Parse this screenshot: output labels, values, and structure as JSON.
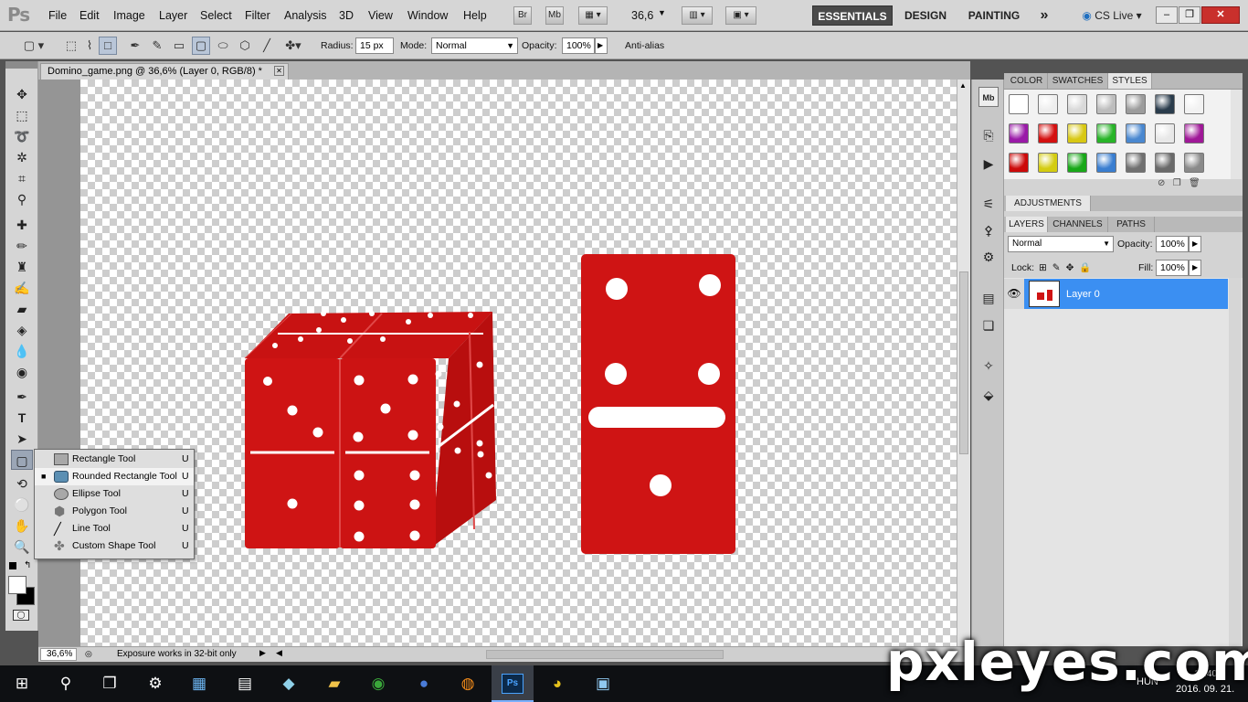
{
  "app": {
    "logo": "Ps"
  },
  "menu": [
    "File",
    "Edit",
    "Image",
    "Layer",
    "Select",
    "Filter",
    "Analysis",
    "3D",
    "View",
    "Window",
    "Help"
  ],
  "menubar_buttons": {
    "bridge": "Br",
    "mini_bridge": "Mb",
    "zoom": "36,6"
  },
  "workspaces": {
    "essentials": "ESSENTIALS",
    "design": "DESIGN",
    "painting": "PAINTING",
    "more": "»",
    "cslive": "CS Live"
  },
  "options": {
    "radius_label": "Radius:",
    "radius_value": "15 px",
    "mode_label": "Mode:",
    "mode_value": "Normal",
    "opacity_label": "Opacity:",
    "opacity_value": "100%",
    "antialias_label": "Anti-alias"
  },
  "document": {
    "tab_title": "Domino_game.png @ 36,6% (Layer 0, RGB/8) *"
  },
  "status": {
    "zoom": "36,6%",
    "message": "Exposure works in 32-bit only"
  },
  "flyout": [
    {
      "name": "Rectangle Tool",
      "key": "U",
      "icon": "rectangle-icon"
    },
    {
      "name": "Rounded Rectangle Tool",
      "key": "U",
      "icon": "rounded-rectangle-icon",
      "current": true
    },
    {
      "name": "Ellipse Tool",
      "key": "U",
      "icon": "ellipse-icon"
    },
    {
      "name": "Polygon Tool",
      "key": "U",
      "icon": "polygon-icon"
    },
    {
      "name": "Line Tool",
      "key": "U",
      "icon": "line-icon"
    },
    {
      "name": "Custom Shape Tool",
      "key": "U",
      "icon": "custom-shape-icon"
    }
  ],
  "panels": {
    "style_tabs": [
      "COLOR",
      "SWATCHES",
      "STYLES"
    ],
    "adjustments": "ADJUSTMENTS",
    "layer_tabs": [
      "LAYERS",
      "CHANNELS",
      "PATHS"
    ],
    "blend_mode": "Normal",
    "opacity_label": "Opacity:",
    "opacity_value": "100%",
    "lock_label": "Lock:",
    "fill_label": "Fill:",
    "fill_value": "100%",
    "layer_name": "Layer 0"
  },
  "style_colors": [
    "#ffffff",
    "#eeeeee",
    "#d9d9d9",
    "#bdbdbd",
    "#9c9c9c",
    "#2a3c4c",
    "#f2f2f2",
    "#9a1aa8",
    "#d41010",
    "#d8c814",
    "#28b428",
    "#4a88d0",
    "#e8e8e8",
    "#a01898",
    "#cc0a0a",
    "#d4cc10",
    "#18a818",
    "#3a7ed0",
    "#707070",
    "#6a6a6a",
    "#8a8a8a"
  ],
  "taskbar": {
    "lang": "HUN",
    "time": "10:40",
    "date": "2016. 09. 21."
  },
  "watermark": "pxleyes.com",
  "accent": "#3b8ff2",
  "domino_color": "#cf1414"
}
